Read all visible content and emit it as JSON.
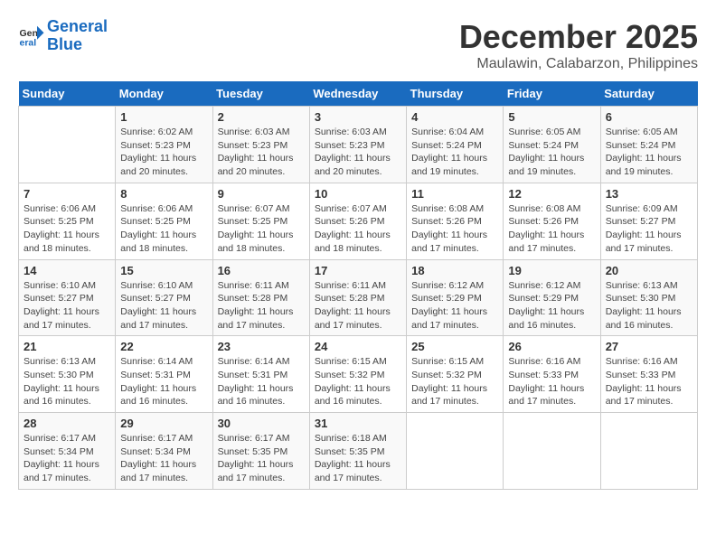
{
  "logo": {
    "line1": "General",
    "line2": "Blue"
  },
  "title": "December 2025",
  "subtitle": "Maulawin, Calabarzon, Philippines",
  "days_header": [
    "Sunday",
    "Monday",
    "Tuesday",
    "Wednesday",
    "Thursday",
    "Friday",
    "Saturday"
  ],
  "weeks": [
    [
      {
        "day": "",
        "info": ""
      },
      {
        "day": "1",
        "info": "Sunrise: 6:02 AM\nSunset: 5:23 PM\nDaylight: 11 hours and 20 minutes."
      },
      {
        "day": "2",
        "info": "Sunrise: 6:03 AM\nSunset: 5:23 PM\nDaylight: 11 hours and 20 minutes."
      },
      {
        "day": "3",
        "info": "Sunrise: 6:03 AM\nSunset: 5:23 PM\nDaylight: 11 hours and 20 minutes."
      },
      {
        "day": "4",
        "info": "Sunrise: 6:04 AM\nSunset: 5:24 PM\nDaylight: 11 hours and 19 minutes."
      },
      {
        "day": "5",
        "info": "Sunrise: 6:05 AM\nSunset: 5:24 PM\nDaylight: 11 hours and 19 minutes."
      },
      {
        "day": "6",
        "info": "Sunrise: 6:05 AM\nSunset: 5:24 PM\nDaylight: 11 hours and 19 minutes."
      }
    ],
    [
      {
        "day": "7",
        "info": "Sunrise: 6:06 AM\nSunset: 5:25 PM\nDaylight: 11 hours and 18 minutes."
      },
      {
        "day": "8",
        "info": "Sunrise: 6:06 AM\nSunset: 5:25 PM\nDaylight: 11 hours and 18 minutes."
      },
      {
        "day": "9",
        "info": "Sunrise: 6:07 AM\nSunset: 5:25 PM\nDaylight: 11 hours and 18 minutes."
      },
      {
        "day": "10",
        "info": "Sunrise: 6:07 AM\nSunset: 5:26 PM\nDaylight: 11 hours and 18 minutes."
      },
      {
        "day": "11",
        "info": "Sunrise: 6:08 AM\nSunset: 5:26 PM\nDaylight: 11 hours and 17 minutes."
      },
      {
        "day": "12",
        "info": "Sunrise: 6:08 AM\nSunset: 5:26 PM\nDaylight: 11 hours and 17 minutes."
      },
      {
        "day": "13",
        "info": "Sunrise: 6:09 AM\nSunset: 5:27 PM\nDaylight: 11 hours and 17 minutes."
      }
    ],
    [
      {
        "day": "14",
        "info": "Sunrise: 6:10 AM\nSunset: 5:27 PM\nDaylight: 11 hours and 17 minutes."
      },
      {
        "day": "15",
        "info": "Sunrise: 6:10 AM\nSunset: 5:27 PM\nDaylight: 11 hours and 17 minutes."
      },
      {
        "day": "16",
        "info": "Sunrise: 6:11 AM\nSunset: 5:28 PM\nDaylight: 11 hours and 17 minutes."
      },
      {
        "day": "17",
        "info": "Sunrise: 6:11 AM\nSunset: 5:28 PM\nDaylight: 11 hours and 17 minutes."
      },
      {
        "day": "18",
        "info": "Sunrise: 6:12 AM\nSunset: 5:29 PM\nDaylight: 11 hours and 17 minutes."
      },
      {
        "day": "19",
        "info": "Sunrise: 6:12 AM\nSunset: 5:29 PM\nDaylight: 11 hours and 16 minutes."
      },
      {
        "day": "20",
        "info": "Sunrise: 6:13 AM\nSunset: 5:30 PM\nDaylight: 11 hours and 16 minutes."
      }
    ],
    [
      {
        "day": "21",
        "info": "Sunrise: 6:13 AM\nSunset: 5:30 PM\nDaylight: 11 hours and 16 minutes."
      },
      {
        "day": "22",
        "info": "Sunrise: 6:14 AM\nSunset: 5:31 PM\nDaylight: 11 hours and 16 minutes."
      },
      {
        "day": "23",
        "info": "Sunrise: 6:14 AM\nSunset: 5:31 PM\nDaylight: 11 hours and 16 minutes."
      },
      {
        "day": "24",
        "info": "Sunrise: 6:15 AM\nSunset: 5:32 PM\nDaylight: 11 hours and 16 minutes."
      },
      {
        "day": "25",
        "info": "Sunrise: 6:15 AM\nSunset: 5:32 PM\nDaylight: 11 hours and 17 minutes."
      },
      {
        "day": "26",
        "info": "Sunrise: 6:16 AM\nSunset: 5:33 PM\nDaylight: 11 hours and 17 minutes."
      },
      {
        "day": "27",
        "info": "Sunrise: 6:16 AM\nSunset: 5:33 PM\nDaylight: 11 hours and 17 minutes."
      }
    ],
    [
      {
        "day": "28",
        "info": "Sunrise: 6:17 AM\nSunset: 5:34 PM\nDaylight: 11 hours and 17 minutes."
      },
      {
        "day": "29",
        "info": "Sunrise: 6:17 AM\nSunset: 5:34 PM\nDaylight: 11 hours and 17 minutes."
      },
      {
        "day": "30",
        "info": "Sunrise: 6:17 AM\nSunset: 5:35 PM\nDaylight: 11 hours and 17 minutes."
      },
      {
        "day": "31",
        "info": "Sunrise: 6:18 AM\nSunset: 5:35 PM\nDaylight: 11 hours and 17 minutes."
      },
      {
        "day": "",
        "info": ""
      },
      {
        "day": "",
        "info": ""
      },
      {
        "day": "",
        "info": ""
      }
    ]
  ]
}
